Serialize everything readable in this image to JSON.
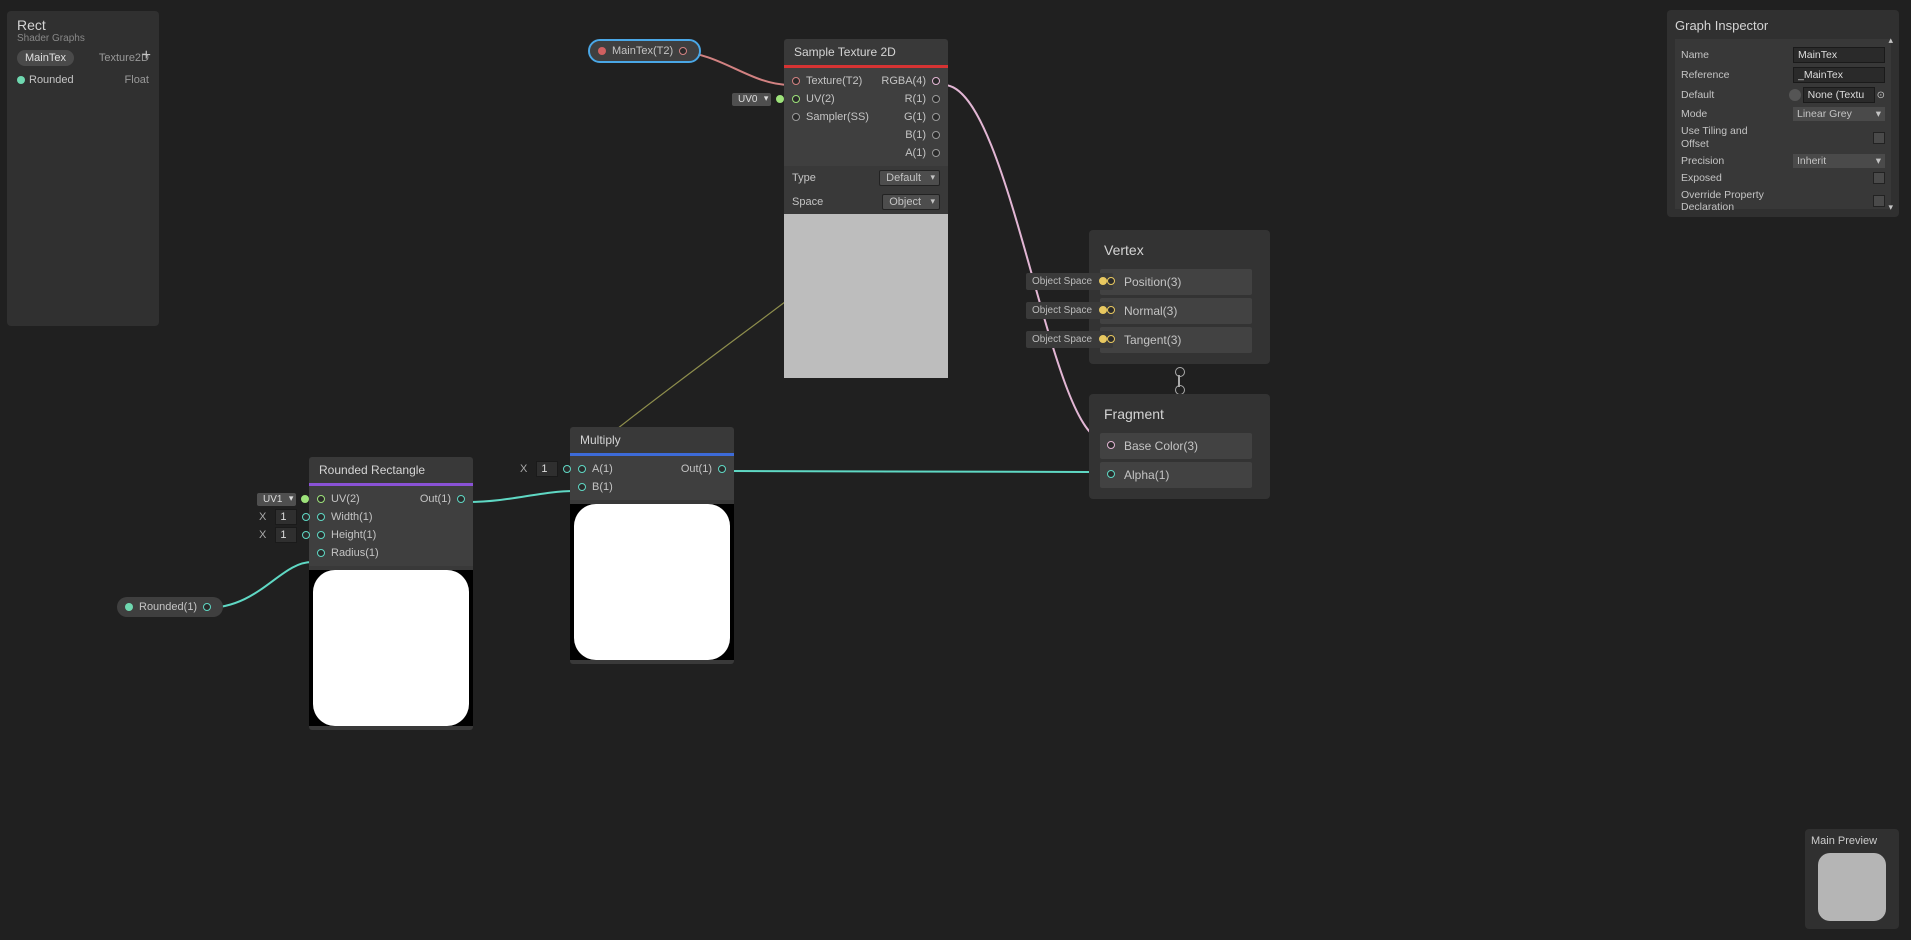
{
  "blackboard": {
    "title": "Rect",
    "subtitle": "Shader Graphs",
    "items": [
      {
        "name": "MainTex",
        "type": "Texture2D",
        "dot": "#d06060"
      },
      {
        "name": "Rounded",
        "type": "Float",
        "dot": "#6fd8b0"
      }
    ]
  },
  "node_maintex": {
    "label": "MainTex(T2)"
  },
  "node_rounded": {
    "label": "Rounded(1)"
  },
  "node_sample": {
    "title": "Sample Texture 2D",
    "in_ports": [
      "Texture(T2)",
      "UV(2)",
      "Sampler(SS)"
    ],
    "out_ports": [
      "RGBA(4)",
      "R(1)",
      "G(1)",
      "B(1)",
      "A(1)"
    ],
    "uv_chip": "UV0",
    "type_label": "Type",
    "type_value": "Default",
    "space_label": "Space",
    "space_value": "Object"
  },
  "node_rrect": {
    "title": "Rounded Rectangle",
    "in_ports": [
      "UV(2)",
      "Width(1)",
      "Height(1)",
      "Radius(1)"
    ],
    "out_port": "Out(1)",
    "uv_chip": "UV1",
    "xvals": {
      "width": "1",
      "height": "1"
    }
  },
  "node_multiply": {
    "title": "Multiply",
    "in_ports": [
      "A(1)",
      "B(1)"
    ],
    "out_port": "Out(1)",
    "xval": "1"
  },
  "master": {
    "vertex_title": "Vertex",
    "vertex_slots": [
      "Position(3)",
      "Normal(3)",
      "Tangent(3)"
    ],
    "slot_tag": "Object Space",
    "fragment_title": "Fragment",
    "fragment_slots": [
      "Base Color(3)",
      "Alpha(1)"
    ]
  },
  "inspector": {
    "title": "Graph Inspector",
    "rows": {
      "name_l": "Name",
      "name_v": "MainTex",
      "ref_l": "Reference",
      "ref_v": "_MainTex",
      "def_l": "Default",
      "def_v": "None (Textu",
      "mode_l": "Mode",
      "mode_v": "Linear Grey",
      "tiling_l": "Use Tiling and Offset",
      "prec_l": "Precision",
      "prec_v": "Inherit",
      "exp_l": "Exposed",
      "ovr_l": "Override Property Declaration"
    }
  },
  "preview": {
    "title": "Main Preview"
  },
  "labels": {
    "x": "X"
  }
}
